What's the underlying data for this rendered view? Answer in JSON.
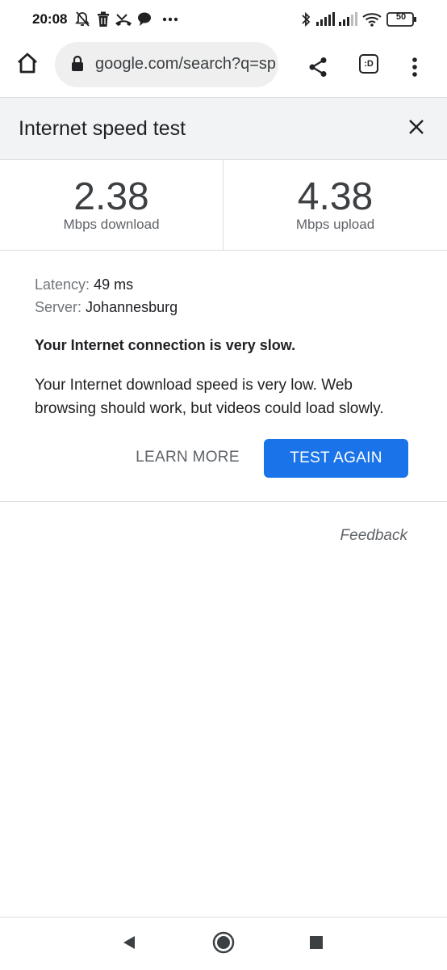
{
  "status_bar": {
    "time": "20:08",
    "battery": "50",
    "left_icons": [
      "bell-off-icon",
      "trash-icon",
      "missed-call-icon",
      "chat-bubble-icon",
      "more-dots-icon"
    ],
    "right_icons": [
      "bluetooth-icon",
      "signal-icon",
      "signal-icon",
      "wifi-icon",
      "battery-icon"
    ]
  },
  "browser": {
    "url": "google.com/search?q=sp",
    "tab_label": ":D"
  },
  "card": {
    "title": "Internet speed test",
    "download": {
      "value": "2.38",
      "unit": "Mbps download"
    },
    "upload": {
      "value": "4.38",
      "unit": "Mbps upload"
    },
    "latency_label": "Latency:",
    "latency_value": "49 ms",
    "server_label": "Server:",
    "server_value": "Johannesburg",
    "headline": "Your Internet connection is very slow.",
    "description": "Your Internet download speed is very low. Web browsing should work, but videos could load slowly.",
    "learn_more": "LEARN MORE",
    "test_again": "TEST AGAIN",
    "feedback": "Feedback"
  },
  "colors": {
    "accent": "#1a73e8",
    "header_bg": "#f1f3f4",
    "text_primary": "#202124",
    "text_secondary": "#5f6368"
  }
}
